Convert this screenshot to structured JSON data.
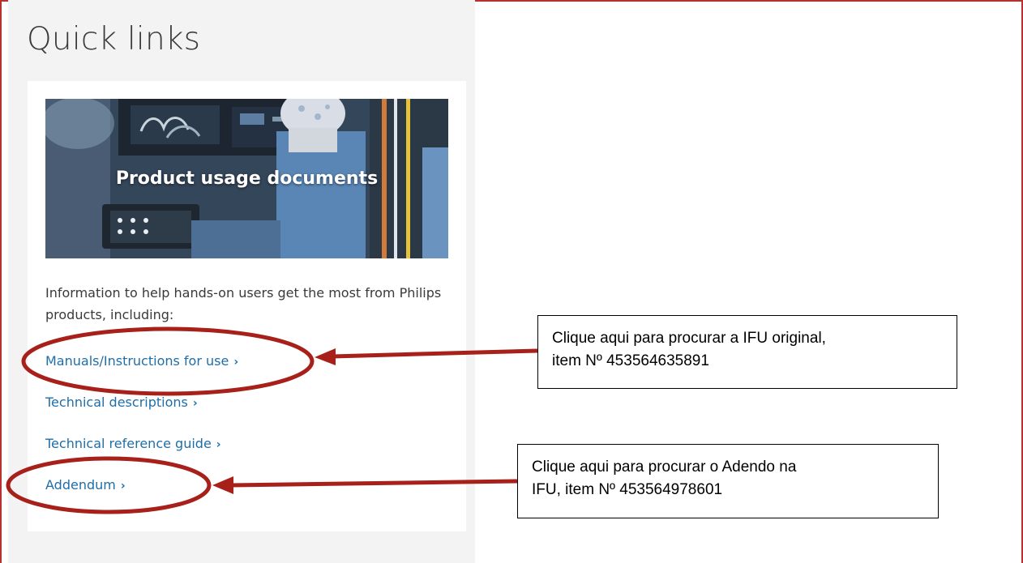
{
  "page": {
    "title": "Quick links"
  },
  "card": {
    "hero_title": "Product usage documents",
    "description": "Information to help hands-on users get the most from Philips products, including:",
    "links": [
      {
        "label": "Manuals/Instructions for use",
        "chevron": "›"
      },
      {
        "label": "Technical descriptions",
        "chevron": "›"
      },
      {
        "label": "Technical reference guide",
        "chevron": "›"
      },
      {
        "label": "Addendum",
        "chevron": "›"
      }
    ]
  },
  "annotations": {
    "callout_ifu": {
      "line1": "Clique aqui para procurar a IFU original,",
      "line2": "item Nº 453564635891"
    },
    "callout_addendum": {
      "line1": "Clique aqui para procurar o Adendo na",
      "line2": "IFU, item Nº 453564978601"
    }
  },
  "colors": {
    "annotation_red": "#a8201a",
    "link_blue": "#1f6ea8",
    "frame_red": "#b8312f"
  }
}
